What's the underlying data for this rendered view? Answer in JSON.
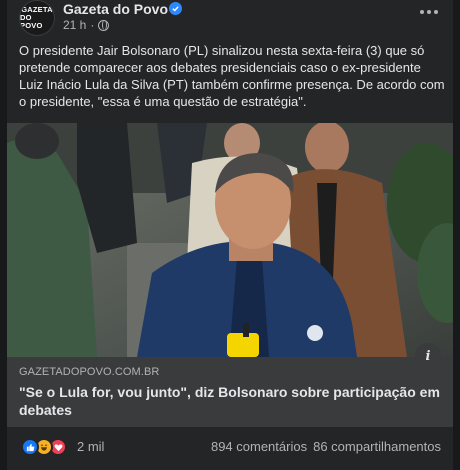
{
  "post": {
    "page_name": "Gazeta do Povo",
    "avatar_text_1": "GAZETA",
    "avatar_text_2": "DO POVO",
    "time": "21 h",
    "dot": "·",
    "body": "O presidente Jair Bolsonaro (PL) sinalizou nesta sexta-feira (3) que só pretende comparecer aos debates presidenciais caso o ex-presidente Luiz Inácio Lula da Silva (PT) também confirme presença. De acordo com o presidente, \"essa é uma questão de estratégia\"."
  },
  "link": {
    "domain": "GAZETADOPOVO.COM.BR",
    "headline": "\"Se o Lula for, vou junto\", diz Bolsonaro sobre participação em debates",
    "info_icon": "i"
  },
  "footer": {
    "reaction_count": "2 mil",
    "comments": "894 comentários",
    "shares": "86 compartilhamentos"
  },
  "icons": {
    "verified": "verified-badge-icon",
    "globe": "globe-icon",
    "more": "more-options-icon",
    "like": "like-reaction-icon",
    "haha": "haha-reaction-icon",
    "love": "love-reaction-icon"
  },
  "colors": {
    "background": "#242526",
    "accent": "#2d88ff",
    "link_box": "#3a3b3c",
    "text": "#e4e6eb",
    "muted": "#b0b3b8"
  }
}
